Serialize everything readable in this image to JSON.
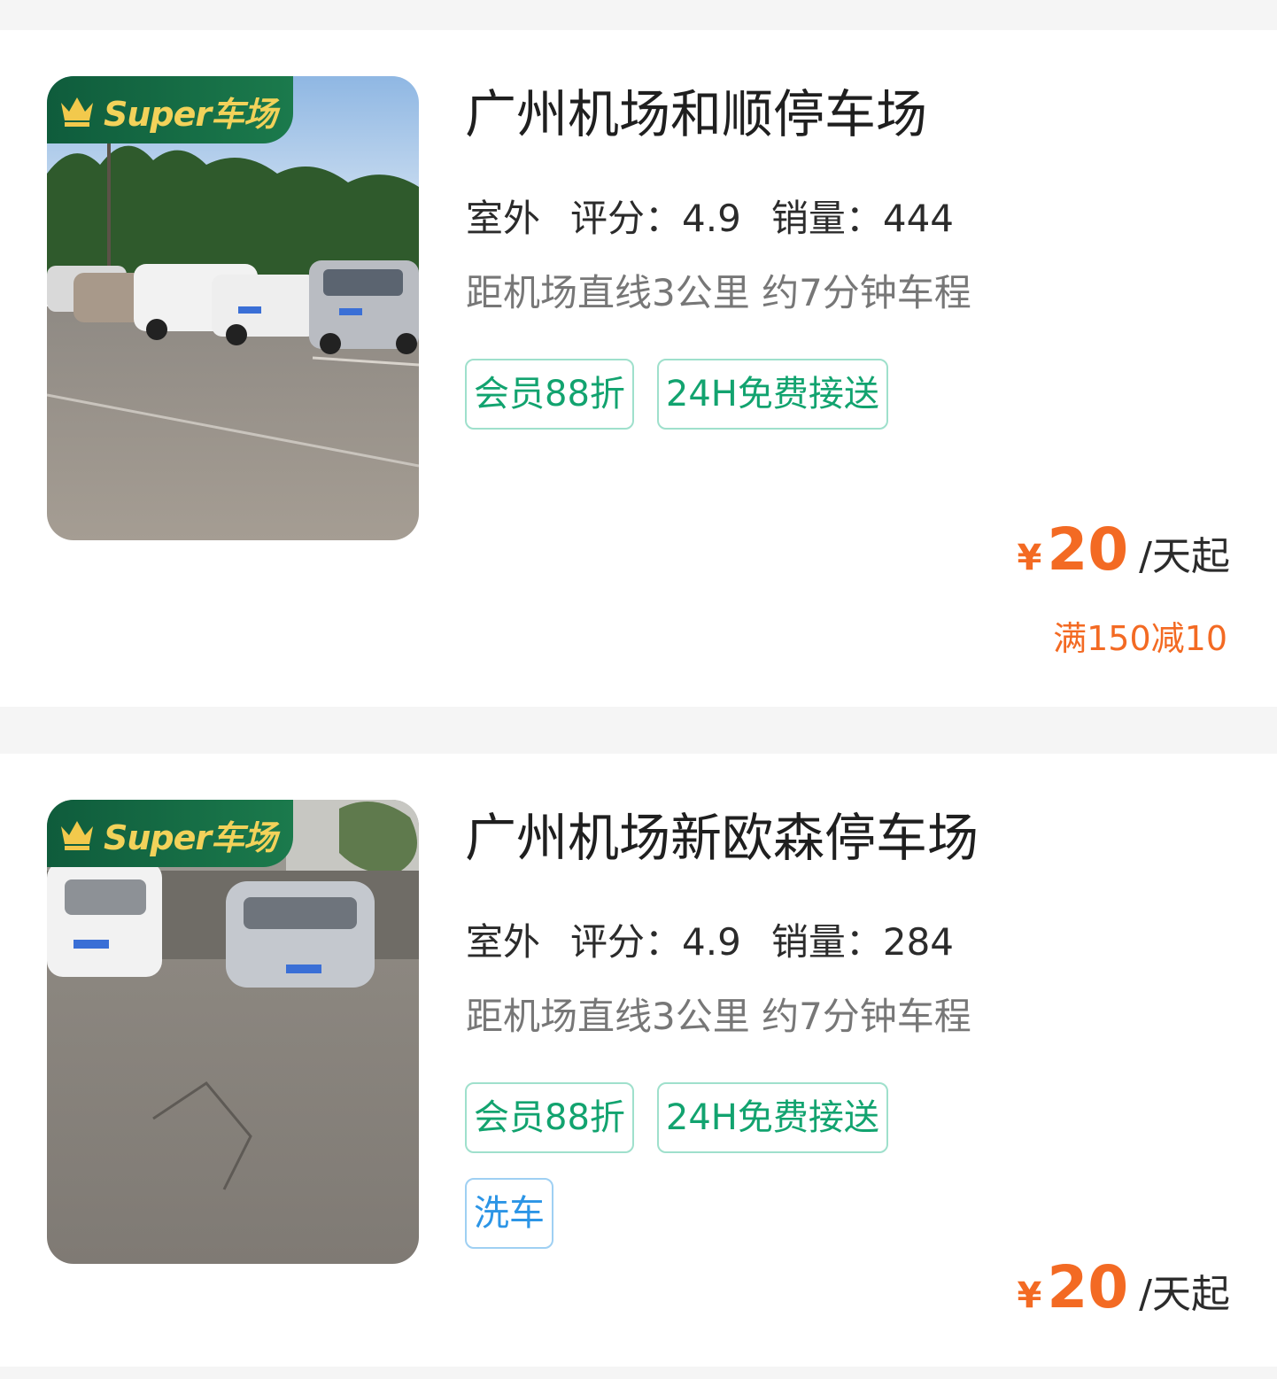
{
  "lots": [
    {
      "badge": "Super车场",
      "name": "广州机场和顺停车场",
      "type": "室外",
      "rating_label": "评分：",
      "rating": "4.9",
      "sales_label": "销量：",
      "sales": "444",
      "distance": "距机场直线3公里 约7分钟车程",
      "tags": [
        "会员88折",
        "24H免费接送"
      ],
      "extra_tag": "",
      "price_symbol": "¥",
      "price": "20",
      "price_unit": "/天起",
      "discount": "满150减10"
    },
    {
      "badge": "Super车场",
      "name": "广州机场新欧森停车场",
      "type": "室外",
      "rating_label": "评分：",
      "rating": "4.9",
      "sales_label": "销量：",
      "sales": "284",
      "distance": "距机场直线3公里 约7分钟车程",
      "tags": [
        "会员88折",
        "24H免费接送"
      ],
      "extra_tag": "洗车",
      "price_symbol": "¥",
      "price": "20",
      "price_unit": "/天起",
      "discount": ""
    }
  ],
  "colors": {
    "accent_orange": "#f36a23",
    "tag_green": "#12a36f",
    "tag_blue": "#2c95e6",
    "badge_green": "#0f5c3c",
    "badge_gold": "#f2d25a"
  },
  "icons": {
    "badge_icon": "crown-icon"
  }
}
